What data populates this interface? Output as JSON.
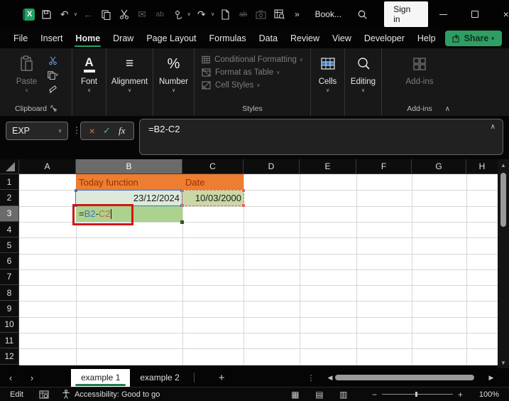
{
  "titlebar": {
    "workbook_title": "Book...",
    "sign_in": "Sign in",
    "overflow": "»"
  },
  "ribbon_tabs": {
    "items": [
      "File",
      "Insert",
      "Home",
      "Draw",
      "Page Layout",
      "Formulas",
      "Data",
      "Review",
      "View",
      "Developer",
      "Help"
    ],
    "active": "Home",
    "share": "Share"
  },
  "ribbon": {
    "clipboard": {
      "paste": "Paste",
      "label": "Clipboard"
    },
    "font": {
      "label": "Font"
    },
    "alignment": {
      "label": "Alignment"
    },
    "number": {
      "label": "Number"
    },
    "styles": {
      "items": [
        "Conditional Formatting",
        "Format as Table",
        "Cell Styles"
      ],
      "label": "Styles"
    },
    "cells": {
      "label": "Cells"
    },
    "editing": {
      "label": "Editing"
    },
    "addins": {
      "button": "Add-ins",
      "label": "Add-ins"
    }
  },
  "formula_bar": {
    "name_box": "EXP",
    "formula": "=B2-C2"
  },
  "sheet": {
    "col_headers": [
      "A",
      "B",
      "C",
      "D",
      "E",
      "F",
      "G",
      "H"
    ],
    "row_headers": [
      "1",
      "2",
      "3",
      "4",
      "5",
      "6",
      "7",
      "8",
      "9",
      "10",
      "11",
      "12"
    ],
    "active_column": "B",
    "active_row": "3",
    "cells": {
      "b1": {
        "ref": "B1",
        "text": "Today function",
        "fill": "#ED7D31",
        "text_color": "#9C3000"
      },
      "c1": {
        "ref": "C1",
        "text": "Date",
        "fill": "#ED7D31",
        "text_color": "#9C3000"
      },
      "b2": {
        "ref": "B2",
        "text": "23/12/2024",
        "fill": "#DCE9DB",
        "border_color": "#4472C4"
      },
      "c2": {
        "ref": "C2",
        "text": "10/03/2000",
        "fill": "#CBD8A6",
        "border_color": "#E2685A"
      },
      "b3": {
        "ref": "B3",
        "eq": "=",
        "ref1": "B2",
        "op": "-",
        "ref2": "C2",
        "fill": "#ABD28F",
        "ref1_color": "#4472C4",
        "ref2_color": "#D0603F",
        "annotation_color": "#D21612"
      }
    }
  },
  "sheet_tabs": {
    "items": [
      "example 1",
      "example 2"
    ],
    "active": "example 1",
    "add": "+"
  },
  "status_bar": {
    "mode": "Edit",
    "accessibility": "Accessibility: Good to go",
    "zoom": "100%"
  },
  "colors": {
    "excel_green": "#21A366",
    "header_orange": "#ED7D31",
    "active_tab_underline": "#2F9E6A"
  }
}
